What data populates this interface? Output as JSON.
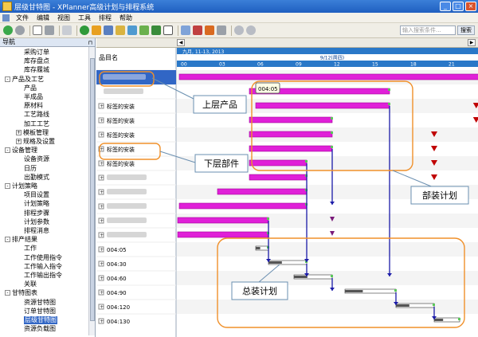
{
  "window": {
    "title": "层级甘特图 - XPlanner高级计划与排程系统",
    "min": "_",
    "max": "□",
    "close": "×"
  },
  "menu": [
    "文件",
    "编辑",
    "视图",
    "工具",
    "排程",
    "帮助"
  ],
  "search": {
    "placeholder": "输入搜索条件...",
    "button": "搜索"
  },
  "nav": {
    "title": "导航",
    "items": [
      {
        "label": "采购订单",
        "level": 2
      },
      {
        "label": "库存盘点",
        "level": 2
      },
      {
        "label": "库存履城",
        "level": 2
      },
      {
        "label": "产品及工艺",
        "level": 1,
        "expander": "-"
      },
      {
        "label": "产品",
        "level": 2
      },
      {
        "label": "半成品",
        "level": 2
      },
      {
        "label": "原材料",
        "level": 2
      },
      {
        "label": "工艺路线",
        "level": 2
      },
      {
        "label": "加工工艺",
        "level": 2
      },
      {
        "label": "模板管理",
        "level": 2,
        "expander": "+"
      },
      {
        "label": "规格及设置",
        "level": 2,
        "expander": "+"
      },
      {
        "label": "设备管理",
        "level": 1,
        "expander": "-"
      },
      {
        "label": "设备资源",
        "level": 2
      },
      {
        "label": "日历",
        "level": 2
      },
      {
        "label": "出勤模式",
        "level": 2
      },
      {
        "label": "计划策略",
        "level": 1,
        "expander": "-"
      },
      {
        "label": "项目设置",
        "level": 2
      },
      {
        "label": "计划策略",
        "level": 2
      },
      {
        "label": "排程步骤",
        "level": 2
      },
      {
        "label": "计划参数",
        "level": 2
      },
      {
        "label": "排程消息",
        "level": 2
      },
      {
        "label": "排产结果",
        "level": 1,
        "expander": "-"
      },
      {
        "label": "工作",
        "level": 2
      },
      {
        "label": "工作使用指令",
        "level": 2
      },
      {
        "label": "工作输入指令",
        "level": 2
      },
      {
        "label": "工作输出指令",
        "level": 2
      },
      {
        "label": "关联",
        "level": 2
      },
      {
        "label": "甘特图表",
        "level": 1,
        "expander": "-"
      },
      {
        "label": "资源甘特图",
        "level": 2
      },
      {
        "label": "订单甘特图",
        "level": 2
      },
      {
        "label": "层级甘特图",
        "level": 2,
        "selected": true
      },
      {
        "label": "资源负载图",
        "level": 2
      }
    ]
  },
  "gantt": {
    "column_header": "品目名",
    "timescale": {
      "range_label": "九月, 11-13, 2013",
      "day_label": "9/12(周四)",
      "hours": [
        "00",
        "03",
        "06",
        "09",
        "12",
        "15",
        "18",
        "21",
        "00",
        "03",
        "06"
      ]
    },
    "rows": [
      {
        "label": ""
      },
      {
        "label": ""
      },
      {
        "label": "标签的安装",
        "expander": "+"
      },
      {
        "label": "标签的安装",
        "expander": "+"
      },
      {
        "label": "标签的安装",
        "expander": "+"
      },
      {
        "label": "标签的安装",
        "expander": "+"
      },
      {
        "label": "标签的安装",
        "expander": "+"
      },
      {
        "label": "",
        "expander": "+"
      },
      {
        "label": "",
        "expander": "+"
      },
      {
        "label": "",
        "expander": "+"
      },
      {
        "label": "",
        "expander": "+"
      },
      {
        "label": "",
        "expander": "+"
      },
      {
        "label": "004:05",
        "expander": "+"
      },
      {
        "label": "004:30",
        "expander": "+"
      },
      {
        "label": "004:60",
        "expander": "+"
      },
      {
        "label": "004:90",
        "expander": "+"
      },
      {
        "label": "004:120",
        "expander": "+"
      },
      {
        "label": "004:130",
        "expander": "+"
      }
    ],
    "tooltip": "004:05",
    "annotations": {
      "upper_product": "上层产品",
      "lower_component": "下层部件",
      "sub_assembly_plan": "部装计划",
      "final_assembly_plan": "总装计划"
    },
    "colors": {
      "bar": "#e020d8",
      "bar_dark": "#a00098",
      "link": "#1a1aa8",
      "marker": "#c00000",
      "annotation": "#f0902a"
    }
  }
}
